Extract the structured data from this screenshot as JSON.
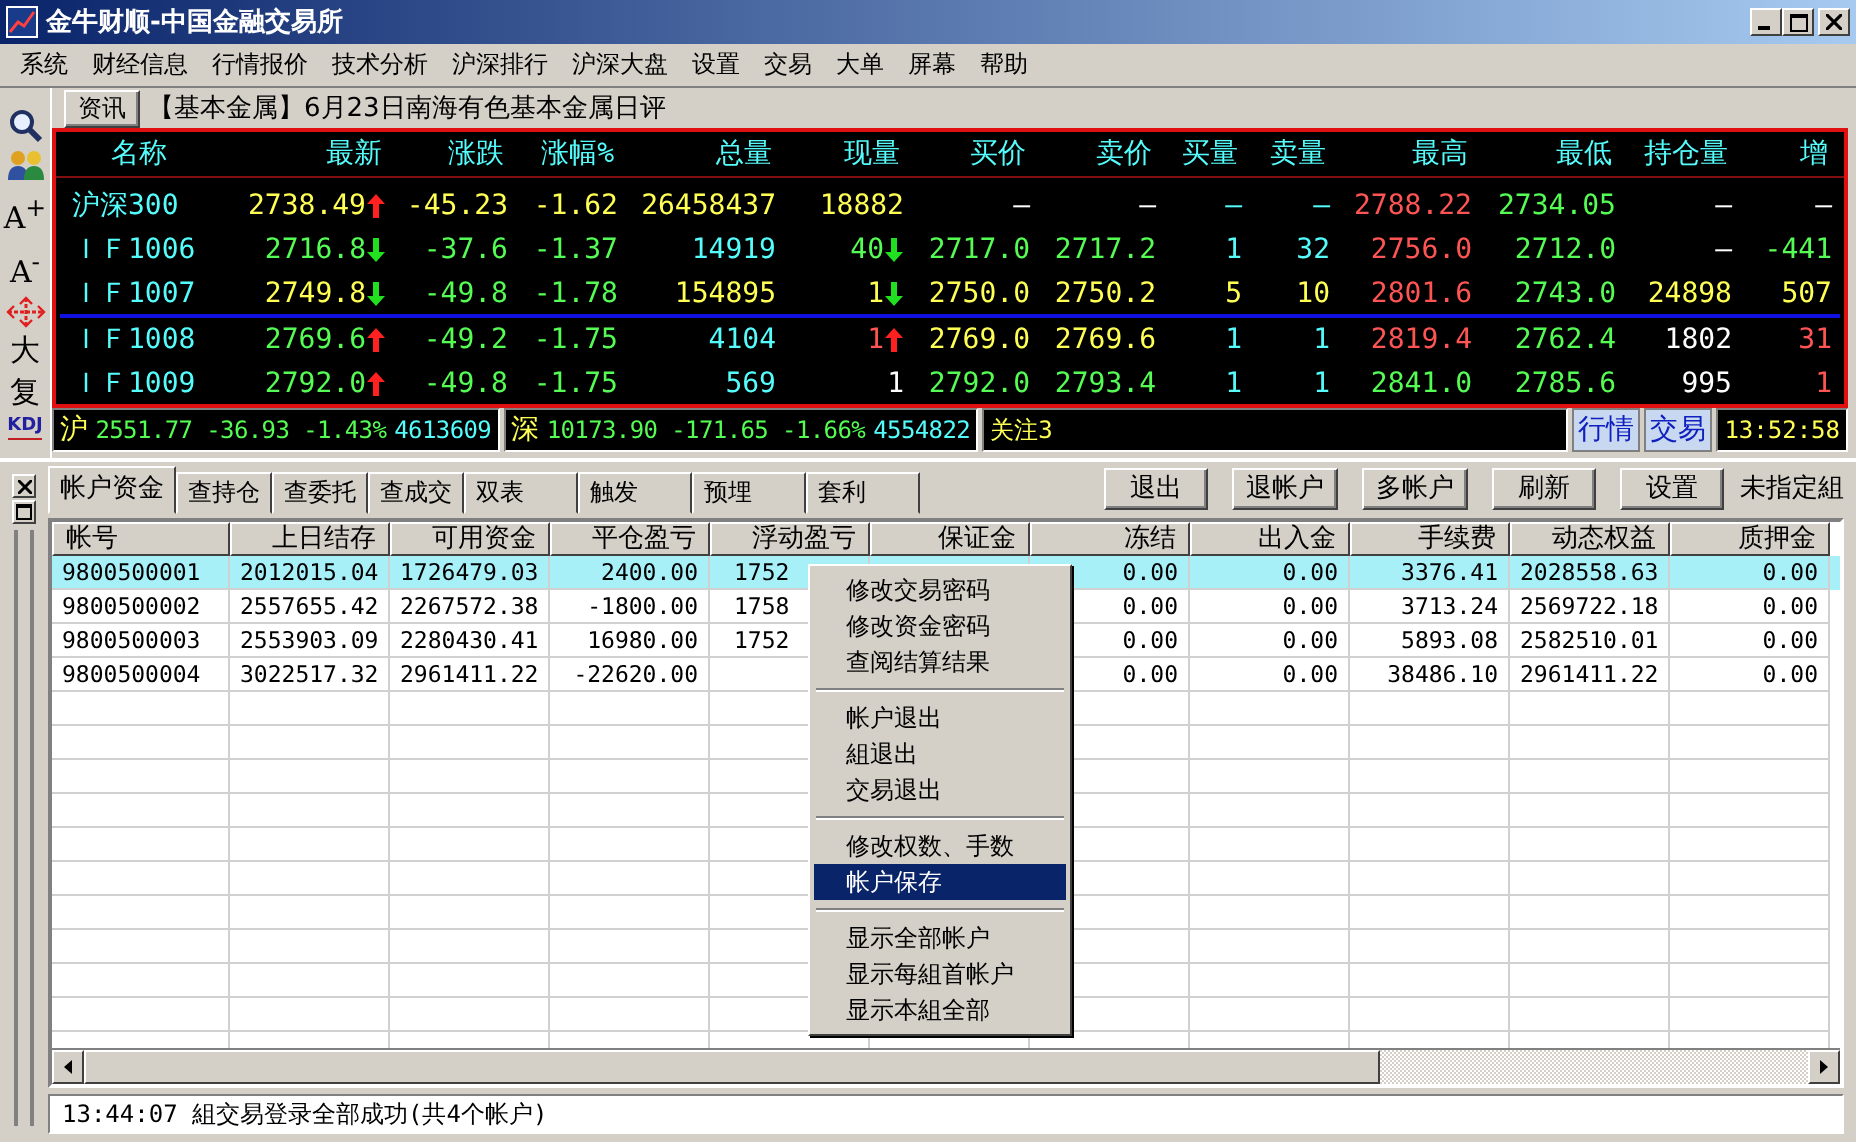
{
  "window": {
    "title": "金牛财顺-中国金融交易所"
  },
  "menu": [
    "系统",
    "财经信息",
    "行情报价",
    "技术分析",
    "沪深排行",
    "沪深大盘",
    "设置",
    "交易",
    "大单",
    "屏幕",
    "帮助"
  ],
  "toolbar": [
    {
      "kind": "icon"
    },
    {
      "kind": "icon"
    },
    {
      "kind": "text",
      "label": "A$^{+}$"
    },
    {
      "kind": "text",
      "label": "A$^{-}$"
    },
    {
      "kind": "icon"
    },
    {
      "kind": "text",
      "label": "大"
    },
    {
      "kind": "text",
      "label": "复"
    },
    {
      "kind": "kdj",
      "label": "KDJ"
    }
  ],
  "news": {
    "button": "资讯",
    "headline": "【基本金属】6月23日南海有色基本金属日评"
  },
  "quote": {
    "name_column": "名称",
    "columns": [
      "最新",
      "涨跌",
      "涨幅%",
      "总量",
      "现量",
      "买价",
      "卖价",
      "买量",
      "卖量",
      "最高",
      "最低",
      "持仓量",
      "增"
    ],
    "rows": [
      {
        "name": "沪深300",
        "divider_after": false,
        "cells": [
          {
            "kind": "up",
            "text": "2738.49",
            "color": "#ffff54"
          },
          {
            "kind": "plain",
            "text": "-45.23",
            "color": "#ffff54"
          },
          {
            "kind": "plain",
            "text": "-1.62",
            "color": "#ffff54"
          },
          {
            "kind": "plain",
            "text": "26458437",
            "color": "#ffff54"
          },
          {
            "kind": "plain",
            "text": "18882",
            "color": "#ffff54"
          },
          {
            "kind": "plain",
            "text": "—",
            "color": "#ffffff"
          },
          {
            "kind": "plain",
            "text": "—",
            "color": "#ffffff"
          },
          {
            "kind": "plain",
            "text": "—",
            "color": "#54fcfc"
          },
          {
            "kind": "plain",
            "text": "—",
            "color": "#54fcfc"
          },
          {
            "kind": "plain",
            "text": "2788.22",
            "color": "#ff5454"
          },
          {
            "kind": "plain",
            "text": "2734.05",
            "color": "#54fc54"
          },
          {
            "kind": "plain",
            "text": "—",
            "color": "#ffffff"
          },
          {
            "kind": "plain",
            "text": "—",
            "color": "#ffffff"
          }
        ]
      },
      {
        "name": "ＩＦ1006",
        "divider_after": false,
        "cells": [
          {
            "kind": "down",
            "text": "2716.8",
            "color": "#54fc54"
          },
          {
            "kind": "plain",
            "text": "-37.6",
            "color": "#54fc54"
          },
          {
            "kind": "plain",
            "text": "-1.37",
            "color": "#54fc54"
          },
          {
            "kind": "plain",
            "text": "14919",
            "color": "#54fcfc"
          },
          {
            "kind": "down",
            "text": "40",
            "color": "#54fc54"
          },
          {
            "kind": "plain",
            "text": "2717.0",
            "color": "#54fc54"
          },
          {
            "kind": "plain",
            "text": "2717.2",
            "color": "#54fc54"
          },
          {
            "kind": "plain",
            "text": "1",
            "color": "#54fcfc"
          },
          {
            "kind": "plain",
            "text": "32",
            "color": "#54fcfc"
          },
          {
            "kind": "plain",
            "text": "2756.0",
            "color": "#ff5454"
          },
          {
            "kind": "plain",
            "text": "2712.0",
            "color": "#54fc54"
          },
          {
            "kind": "plain",
            "text": "—",
            "color": "#ffffff"
          },
          {
            "kind": "plain",
            "text": "-441",
            "color": "#54fc54"
          }
        ]
      },
      {
        "name": "ＩＦ1007",
        "divider_after": true,
        "cells": [
          {
            "kind": "down",
            "text": "2749.8",
            "color": "#ffff54"
          },
          {
            "kind": "plain",
            "text": "-49.8",
            "color": "#54fc54"
          },
          {
            "kind": "plain",
            "text": "-1.78",
            "color": "#54fc54"
          },
          {
            "kind": "plain",
            "text": "154895",
            "color": "#ffff54"
          },
          {
            "kind": "down",
            "text": "1",
            "color": "#ffff54"
          },
          {
            "kind": "plain",
            "text": "2750.0",
            "color": "#ffff54"
          },
          {
            "kind": "plain",
            "text": "2750.2",
            "color": "#ffff54"
          },
          {
            "kind": "plain",
            "text": "5",
            "color": "#ffff54"
          },
          {
            "kind": "plain",
            "text": "10",
            "color": "#ffff54"
          },
          {
            "kind": "plain",
            "text": "2801.6",
            "color": "#ff5454"
          },
          {
            "kind": "plain",
            "text": "2743.0",
            "color": "#54fc54"
          },
          {
            "kind": "plain",
            "text": "24898",
            "color": "#ffff54"
          },
          {
            "kind": "plain",
            "text": "507",
            "color": "#ffff54"
          }
        ]
      },
      {
        "name": "ＩＦ1008",
        "divider_after": false,
        "cells": [
          {
            "kind": "up",
            "text": "2769.6",
            "color": "#54fc54"
          },
          {
            "kind": "plain",
            "text": "-49.2",
            "color": "#54fc54"
          },
          {
            "kind": "plain",
            "text": "-1.75",
            "color": "#54fc54"
          },
          {
            "kind": "plain",
            "text": "4104",
            "color": "#54fcfc"
          },
          {
            "kind": "up",
            "text": "1",
            "color": "#ff5454"
          },
          {
            "kind": "plain",
            "text": "2769.0",
            "color": "#ffff54"
          },
          {
            "kind": "plain",
            "text": "2769.6",
            "color": "#ffff54"
          },
          {
            "kind": "plain",
            "text": "1",
            "color": "#54fcfc"
          },
          {
            "kind": "plain",
            "text": "1",
            "color": "#54fcfc"
          },
          {
            "kind": "plain",
            "text": "2819.4",
            "color": "#ff5454"
          },
          {
            "kind": "plain",
            "text": "2762.4",
            "color": "#54fc54"
          },
          {
            "kind": "plain",
            "text": "1802",
            "color": "#ffffff"
          },
          {
            "kind": "plain",
            "text": "31",
            "color": "#ff5454"
          }
        ]
      },
      {
        "name": "ＩＦ1009",
        "divider_after": false,
        "cells": [
          {
            "kind": "up",
            "text": "2792.0",
            "color": "#54fc54"
          },
          {
            "kind": "plain",
            "text": "-49.8",
            "color": "#54fc54"
          },
          {
            "kind": "plain",
            "text": "-1.75",
            "color": "#54fc54"
          },
          {
            "kind": "plain",
            "text": "569",
            "color": "#54fcfc"
          },
          {
            "kind": "plain",
            "text": "1",
            "color": "#ffffff"
          },
          {
            "kind": "plain",
            "text": "2792.0",
            "color": "#54fc54"
          },
          {
            "kind": "plain",
            "text": "2793.4",
            "color": "#54fc54"
          },
          {
            "kind": "plain",
            "text": "1",
            "color": "#54fcfc"
          },
          {
            "kind": "plain",
            "text": "1",
            "color": "#54fcfc"
          },
          {
            "kind": "plain",
            "text": "2841.0",
            "color": "#54fc54"
          },
          {
            "kind": "plain",
            "text": "2785.6",
            "color": "#54fc54"
          },
          {
            "kind": "plain",
            "text": "995",
            "color": "#ffffff"
          },
          {
            "kind": "plain",
            "text": "1",
            "color": "#ff5454"
          }
        ]
      }
    ]
  },
  "index_bar": {
    "indices": [
      {
        "label": "沪",
        "quote": "2551.77 -36.93 -1.43%",
        "volume": "4613609"
      },
      {
        "label": "深",
        "quote": "10173.90 -171.65 -1.66%",
        "volume": "4554822"
      }
    ],
    "watch": "关注3",
    "buttons": [
      "行情",
      "交易"
    ],
    "time": "13:52:58"
  },
  "tabs": [
    {
      "label": "帐户资金",
      "selected": true
    },
    {
      "label": "查持仓",
      "selected": false
    },
    {
      "label": "查委托",
      "selected": false
    },
    {
      "label": "查成交",
      "selected": false
    },
    {
      "label": "双表",
      "selected": false
    },
    {
      "label": "触发",
      "selected": false
    },
    {
      "label": "预埋",
      "selected": false
    },
    {
      "label": "套利",
      "selected": false
    }
  ],
  "actions": [
    "退出",
    "退帐户",
    "多帐户",
    "刷新",
    "设置"
  ],
  "group_label": "未指定組",
  "table": {
    "columns": [
      "帐号",
      "上日结存",
      "可用资金",
      "平仓盈亏",
      "浮动盈亏",
      "保证金",
      "冻结",
      "出入金",
      "手续费",
      "动态权益",
      "质押金"
    ],
    "rows": [
      {
        "selected": true,
        "cells": [
          "9800500001",
          "2012015.04",
          "1726479.03",
          "2400.00",
          "1752",
          null,
          "0.00",
          "0.00",
          "3376.41",
          "2028558.63",
          "0.00"
        ]
      },
      {
        "selected": false,
        "cells": [
          "9800500002",
          "2557655.42",
          "2267572.38",
          "-1800.00",
          "1758",
          null,
          "0.00",
          "0.00",
          "3713.24",
          "2569722.18",
          "0.00"
        ]
      },
      {
        "selected": false,
        "cells": [
          "9800500003",
          "2553903.09",
          "2280430.41",
          "16980.00",
          "1752",
          null,
          "0.00",
          "0.00",
          "5893.08",
          "2582510.01",
          "0.00"
        ]
      },
      {
        "selected": false,
        "cells": [
          "9800500004",
          "3022517.32",
          "2961411.22",
          "-22620.00",
          null,
          null,
          "0.00",
          "0.00",
          "38486.10",
          "2961411.22",
          "0.00"
        ]
      }
    ]
  },
  "context_menu": {
    "sections": [
      {
        "items": [
          {
            "label": "修改交易密码",
            "selected": false
          },
          {
            "label": "修改资金密码",
            "selected": false
          },
          {
            "label": "查阅结算结果",
            "selected": false
          }
        ]
      },
      {
        "items": [
          {
            "label": "帐户退出",
            "selected": false
          },
          {
            "label": "組退出",
            "selected": false
          },
          {
            "label": "交易退出",
            "selected": false
          }
        ]
      },
      {
        "items": [
          {
            "label": "修改权数、手数",
            "selected": false
          },
          {
            "label": "帐户保存",
            "selected": true
          }
        ]
      },
      {
        "items": [
          {
            "label": "显示全部帐户",
            "selected": false
          },
          {
            "label": "显示每組首帐户",
            "selected": false
          },
          {
            "label": "显示本組全部",
            "selected": false
          }
        ]
      }
    ]
  },
  "status": "13:44:07 組交易登录全部成功(共4个帐户)"
}
